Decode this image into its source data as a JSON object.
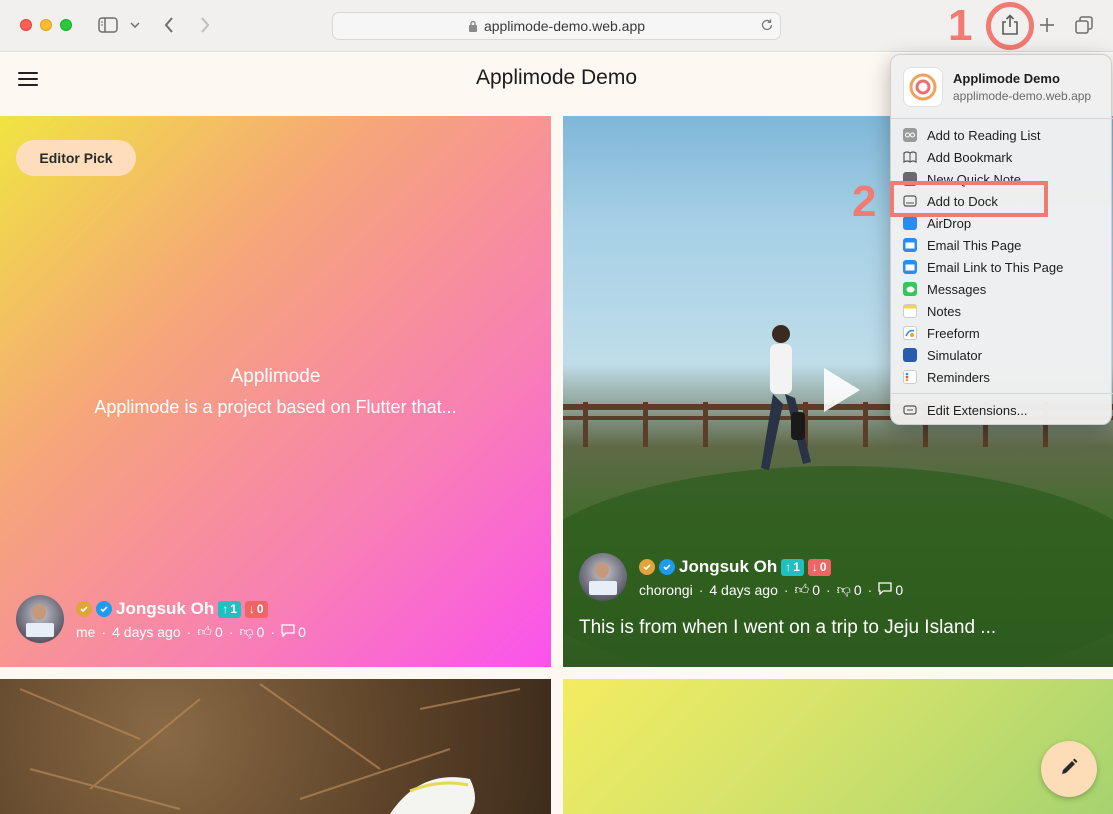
{
  "browser": {
    "url": "applimode-demo.web.app"
  },
  "annotations": {
    "step1": "1",
    "step2": "2"
  },
  "app": {
    "title": "Applimode Demo"
  },
  "cards": [
    {
      "badge": "Editor Pick",
      "title": "Applimode",
      "description": "Applimode is a project based on Flutter that...",
      "author": "Jongsuk Oh",
      "upvotes": "1",
      "downvotes": "0",
      "username": "me",
      "time": "4 days ago",
      "likes": "0",
      "dislikes": "0",
      "comments": "0"
    },
    {
      "author": "Jongsuk Oh",
      "upvotes": "1",
      "downvotes": "0",
      "username": "chorongi",
      "time": "4 days ago",
      "likes": "0",
      "dislikes": "0",
      "comments": "0",
      "caption": "This is from when I went on a trip to Jeju Island ..."
    }
  ],
  "share_menu": {
    "app_name": "Applimode Demo",
    "app_url": "applimode-demo.web.app",
    "items": [
      {
        "label": "Add to Reading List",
        "icon": "reading-list-icon"
      },
      {
        "label": "Add Bookmark",
        "icon": "bookmark-icon"
      },
      {
        "label": "New Quick Note",
        "icon": "quick-note-icon"
      },
      {
        "label": "Add to Dock",
        "icon": "dock-icon"
      },
      {
        "label": "AirDrop",
        "icon": "airdrop-icon"
      },
      {
        "label": "Email This Page",
        "icon": "mail-icon"
      },
      {
        "label": "Email Link to This Page",
        "icon": "mail-icon"
      },
      {
        "label": "Messages",
        "icon": "messages-icon"
      },
      {
        "label": "Notes",
        "icon": "notes-icon"
      },
      {
        "label": "Freeform",
        "icon": "freeform-icon"
      },
      {
        "label": "Simulator",
        "icon": "simulator-icon"
      },
      {
        "label": "Reminders",
        "icon": "reminders-icon"
      }
    ],
    "footer": "Edit Extensions..."
  },
  "colors": {
    "annotation": "#ef7b72",
    "upvote": "#1fc0c2",
    "downvote": "#ef6565",
    "fab": "#fddcb8"
  }
}
